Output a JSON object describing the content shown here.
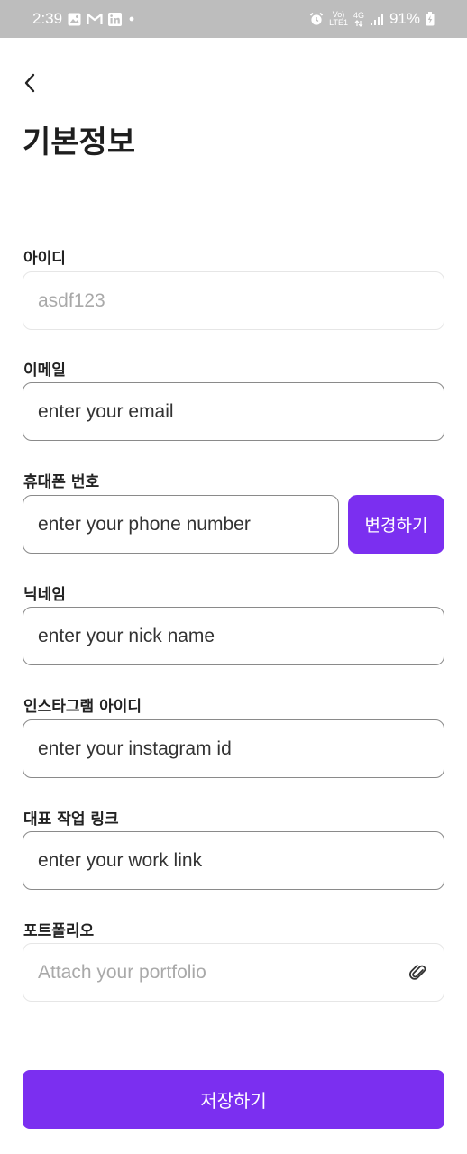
{
  "status_bar": {
    "time": "2:39",
    "battery": "91%",
    "volte_top": "Vo)",
    "volte_bottom": "LTE1",
    "network": "4G",
    "notification_icons": [
      "gallery-icon",
      "gmail-icon",
      "linkedin-icon",
      "dot-icon"
    ],
    "system_icons": [
      "alarm-icon",
      "volte-icon",
      "4g-icon",
      "signal-icon",
      "battery-charging-icon"
    ]
  },
  "header": {
    "back_icon": "chevron-left-icon",
    "title": "기본정보"
  },
  "form": {
    "id_label": "아이디",
    "id_value": "asdf123",
    "email_label": "이메일",
    "email_placeholder": "enter your email",
    "phone_label": "휴대폰 번호",
    "phone_placeholder": "enter your phone number",
    "phone_change_label": "변경하기",
    "nickname_label": "닉네임",
    "nickname_placeholder": "enter your nick name",
    "instagram_label": "인스타그램 아이디",
    "instagram_placeholder": "enter your instagram id",
    "worklink_label": "대표 작업 링크",
    "worklink_placeholder": "enter your work link",
    "portfolio_label": "포트폴리오",
    "portfolio_placeholder": "Attach your portfolio",
    "portfolio_icon": "paperclip-icon"
  },
  "footer": {
    "save_label": "저장하기"
  },
  "colors": {
    "accent": "#7b2ff0",
    "statusbar": "#bdbdbd",
    "border": "#8a8a8a",
    "border_light": "#e6e6e6",
    "placeholder_light": "#a9a9a9",
    "text": "#333333"
  }
}
